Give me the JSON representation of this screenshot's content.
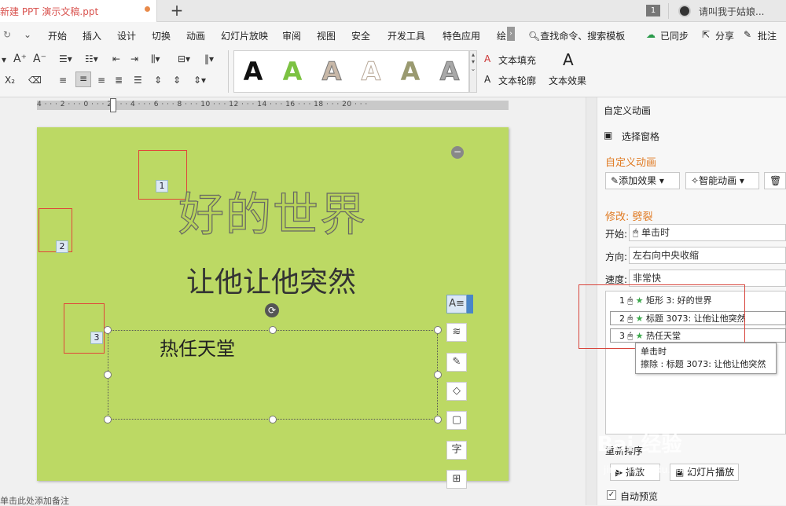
{
  "tabbar": {
    "doc_title": "新建 PPT 演示文稿.ppt",
    "new_tab": "+",
    "tab_count": "1",
    "user_hint": "请叫我于姑娘..."
  },
  "menu": {
    "items": [
      "开始",
      "插入",
      "设计",
      "切换",
      "动画",
      "幻灯片放映",
      "审阅",
      "视图",
      "安全",
      "开发工具",
      "特色应用",
      "绘"
    ],
    "search": "查找命令、搜索模板",
    "sync": "已同步",
    "share": "分享",
    "comment": "批注"
  },
  "ribbon": {
    "gallery_letter": "A",
    "text_fill": "文本填充",
    "text_outline": "文本轮廓",
    "text_effect": "文本效果",
    "effect_icon_letter": "A"
  },
  "ruler": {
    "labels": "4 · · · 2 · · · 0 · · · 2 · · · 4 · · · 6 · · · 8 · · · 10 · · · 12 · · · 14 · · · 16 · · · 18 · · · 20 · · ·"
  },
  "slide": {
    "title": "好的世界",
    "subtitle": "让他让他突然",
    "body": "热任天堂",
    "tags": [
      "1",
      "2",
      "3"
    ]
  },
  "float_tools": {
    "icons": [
      "A≡",
      "≋",
      "✎",
      "◇",
      "▢",
      "字",
      "⊞"
    ]
  },
  "notes": "单击此处添加备注",
  "panel": {
    "header": "自定义动画",
    "select_pane": "选择窗格",
    "section_title": "自定义动画",
    "add_effect": "添加效果",
    "smart_anim": "智能动画",
    "modify": "修改: 劈裂",
    "start_label": "开始:",
    "start_value": "单击时",
    "dir_label": "方向:",
    "dir_value": "左右向中央收缩",
    "speed_label": "速度:",
    "speed_value": "非常快",
    "anim_items": [
      {
        "num": "1",
        "text": "矩形 3: 好的世界"
      },
      {
        "num": "2",
        "text": "标题 3073: 让他让他突然"
      },
      {
        "num": "3",
        "text": "热任天堂"
      }
    ],
    "tooltip_line1": "单击时",
    "tooltip_line2": "擦除 : 标题 3073: 让他让他突然",
    "reorder": "重新排序",
    "play": "播放",
    "slideshow": "幻灯片播放",
    "auto_preview": "自动预览"
  },
  "watermark": {
    "brand": "Bai 经验",
    "url": "jingyan.baidu.com"
  },
  "colors": {
    "slide_bg": "#bcd964",
    "accent_orange": "#e07b24",
    "highlight_red": "#e0453a"
  }
}
